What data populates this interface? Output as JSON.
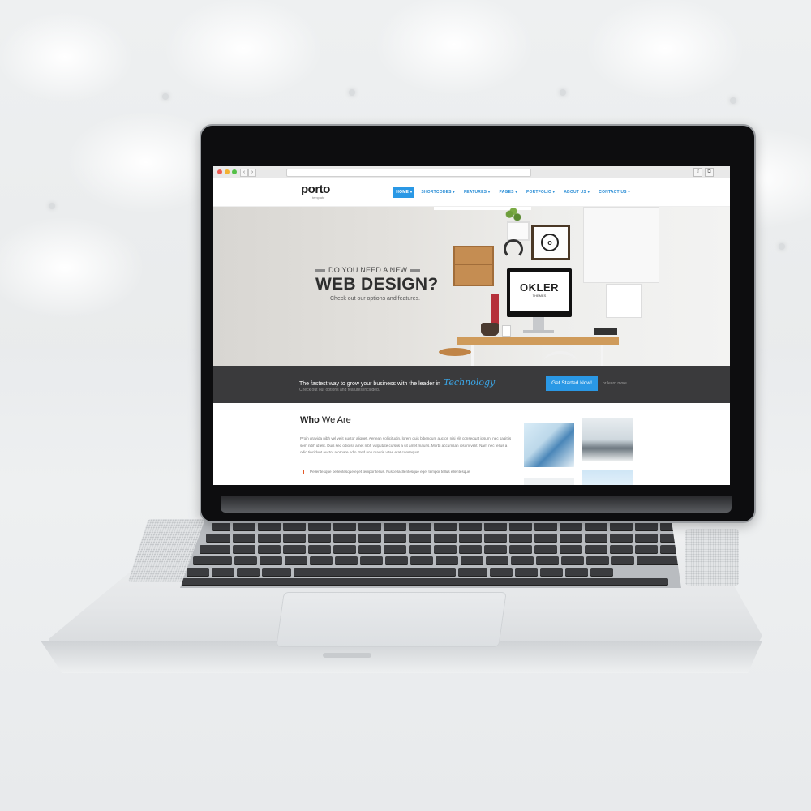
{
  "browser": {
    "back_icon": "chevron-left-icon",
    "forward_icon": "chevron-right-icon",
    "share_icon": "share-icon",
    "tabs_icon": "tabs-icon"
  },
  "site": {
    "logo_text": "porto",
    "logo_tagline": "template",
    "nav": [
      "HOME",
      "SHORTCODES",
      "FEATURES",
      "PAGES",
      "PORTFOLIO",
      "ABOUT US",
      "CONTACT US"
    ],
    "active_nav": "HOME",
    "accent_color": "#2a98e5"
  },
  "hero": {
    "kicker": "DO YOU NEED A NEW",
    "title": "WEB DESIGN?",
    "subtitle": "Check out our options and features.",
    "monitor_brand": "OKLER",
    "monitor_tagline": "THEMES"
  },
  "cta": {
    "text": "The fastest way to grow your business with the leader in",
    "accent": "Technology",
    "subtext": "Check out our options and features included.",
    "button": "Get Started Now!",
    "learn_more": "or learn more."
  },
  "about": {
    "title_bold": "Who",
    "title_rest": " We Are",
    "paragraph": "Proin gravida nibh vel velit auctor aliquet. Aenean sollicitudin, lorem quis bibendum auctor, nisi elit consequat ipsum, nec sagittis sem nibh id elit. Duis sed odio sit amet nibh vulputate cursus a sit amet mauris. Morbi accumsan ipsum velit. Nam nec tellus a odio tincidunt auctor a ornare odio. Sed non mauris vitae erat consequat.",
    "quote": "Pellentesque pellentesque eget tempor tellus. Fusce lacllentesque eget tempor tellus ellentesque"
  }
}
